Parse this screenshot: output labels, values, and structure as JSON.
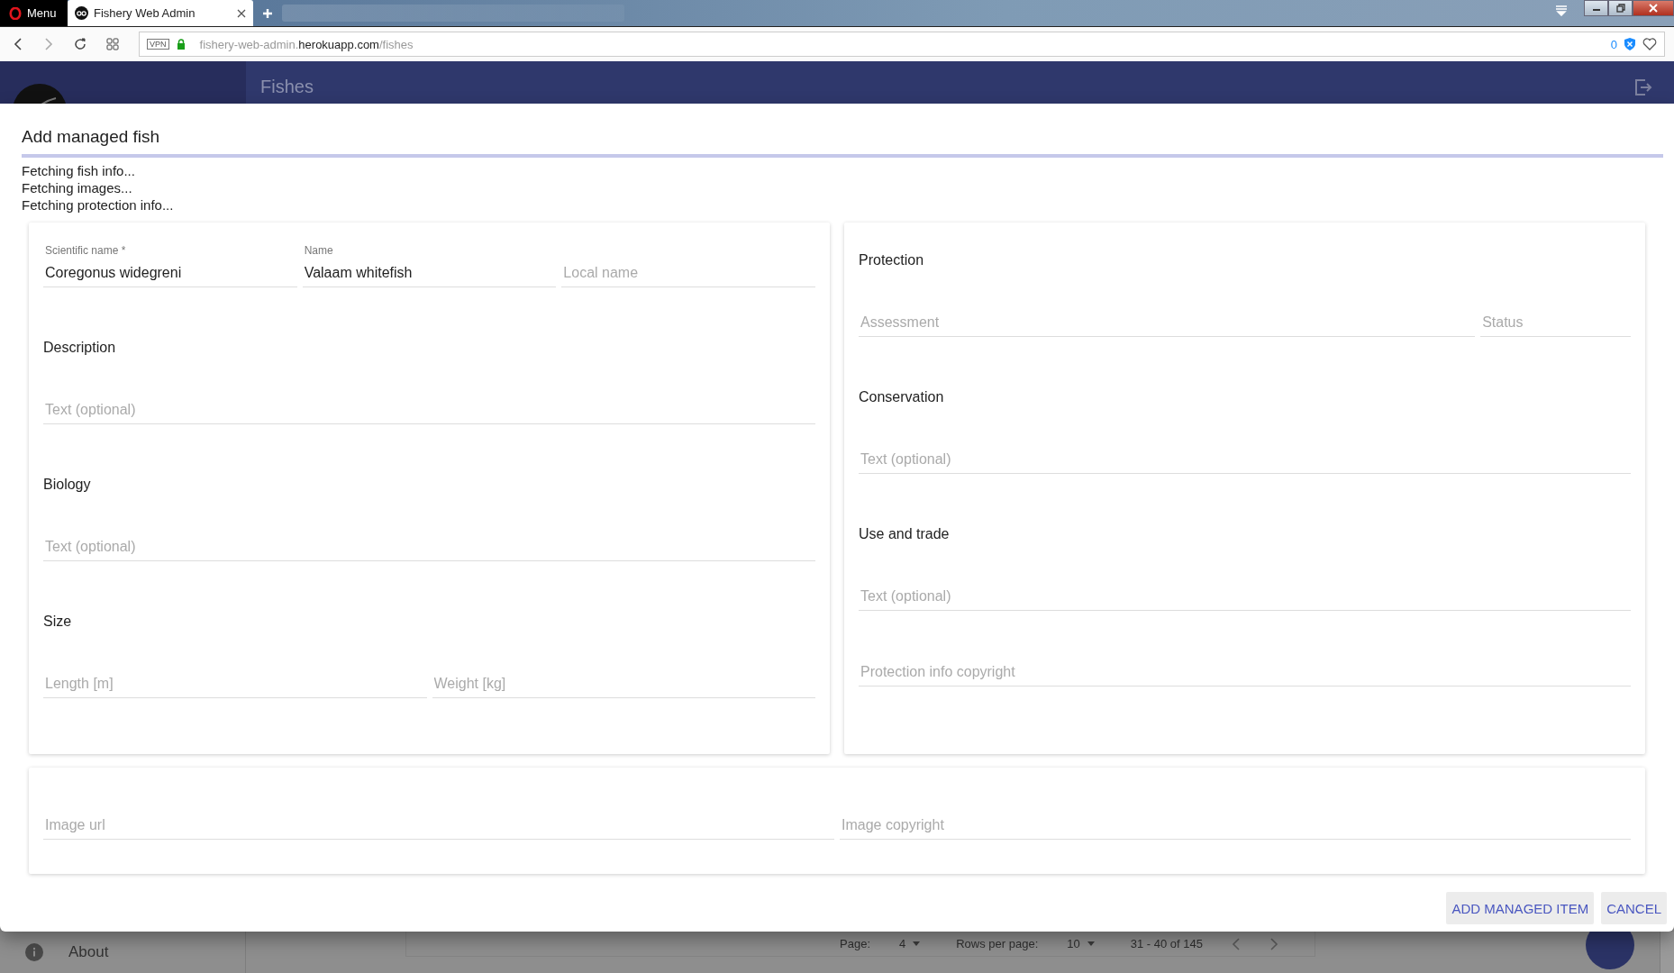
{
  "browser": {
    "menu_label": "Menu",
    "active_tab": "Fishery Web Admin",
    "url": {
      "subdomain": "fishery-web-admin.",
      "domain": "herokuapp.com",
      "path": "/fishes"
    },
    "vpn": "VPN",
    "blocked_count": "0"
  },
  "app": {
    "page_title": "Fishes",
    "sidebar_item": "About"
  },
  "pagination": {
    "page_label": "Page:",
    "page": "4",
    "rows_label": "Rows per page:",
    "rows": "10",
    "range": "31 - 40 of 145"
  },
  "dialog": {
    "title": "Add managed fish",
    "status_lines": [
      "Fetching fish info...",
      "Fetching images...",
      "Fetching protection info..."
    ],
    "left_card": {
      "top_fields": [
        {
          "label": "Scientific name *",
          "value": "Coregonus widegreni"
        },
        {
          "label": "Name",
          "value": "Valaam whitefish"
        },
        {
          "placeholder": "Local name"
        }
      ],
      "sections": [
        {
          "heading": "Description",
          "fields": [
            {
              "placeholder": "Text (optional)"
            }
          ]
        },
        {
          "heading": "Biology",
          "fields": [
            {
              "placeholder": "Text (optional)"
            }
          ]
        },
        {
          "heading": "Size",
          "fields": [
            {
              "placeholder": "Length [m]"
            },
            {
              "placeholder": "Weight [kg]"
            }
          ]
        }
      ]
    },
    "right_card": {
      "sections": [
        {
          "heading": "Protection",
          "fields": [
            {
              "placeholder": "Assessment"
            },
            {
              "placeholder": "Status"
            }
          ]
        },
        {
          "heading": "Conservation",
          "fields": [
            {
              "placeholder": "Text (optional)"
            }
          ]
        },
        {
          "heading": "Use and trade",
          "fields": [
            {
              "placeholder": "Text (optional)"
            }
          ]
        },
        {
          "fields": [
            {
              "placeholder": "Protection info copyright"
            }
          ]
        }
      ]
    },
    "image_card": {
      "fields": [
        {
          "placeholder": "Image url"
        },
        {
          "placeholder": "Image copyright"
        }
      ]
    },
    "buttons": [
      "ADD MANAGED ITEM",
      "CANCEL"
    ]
  }
}
